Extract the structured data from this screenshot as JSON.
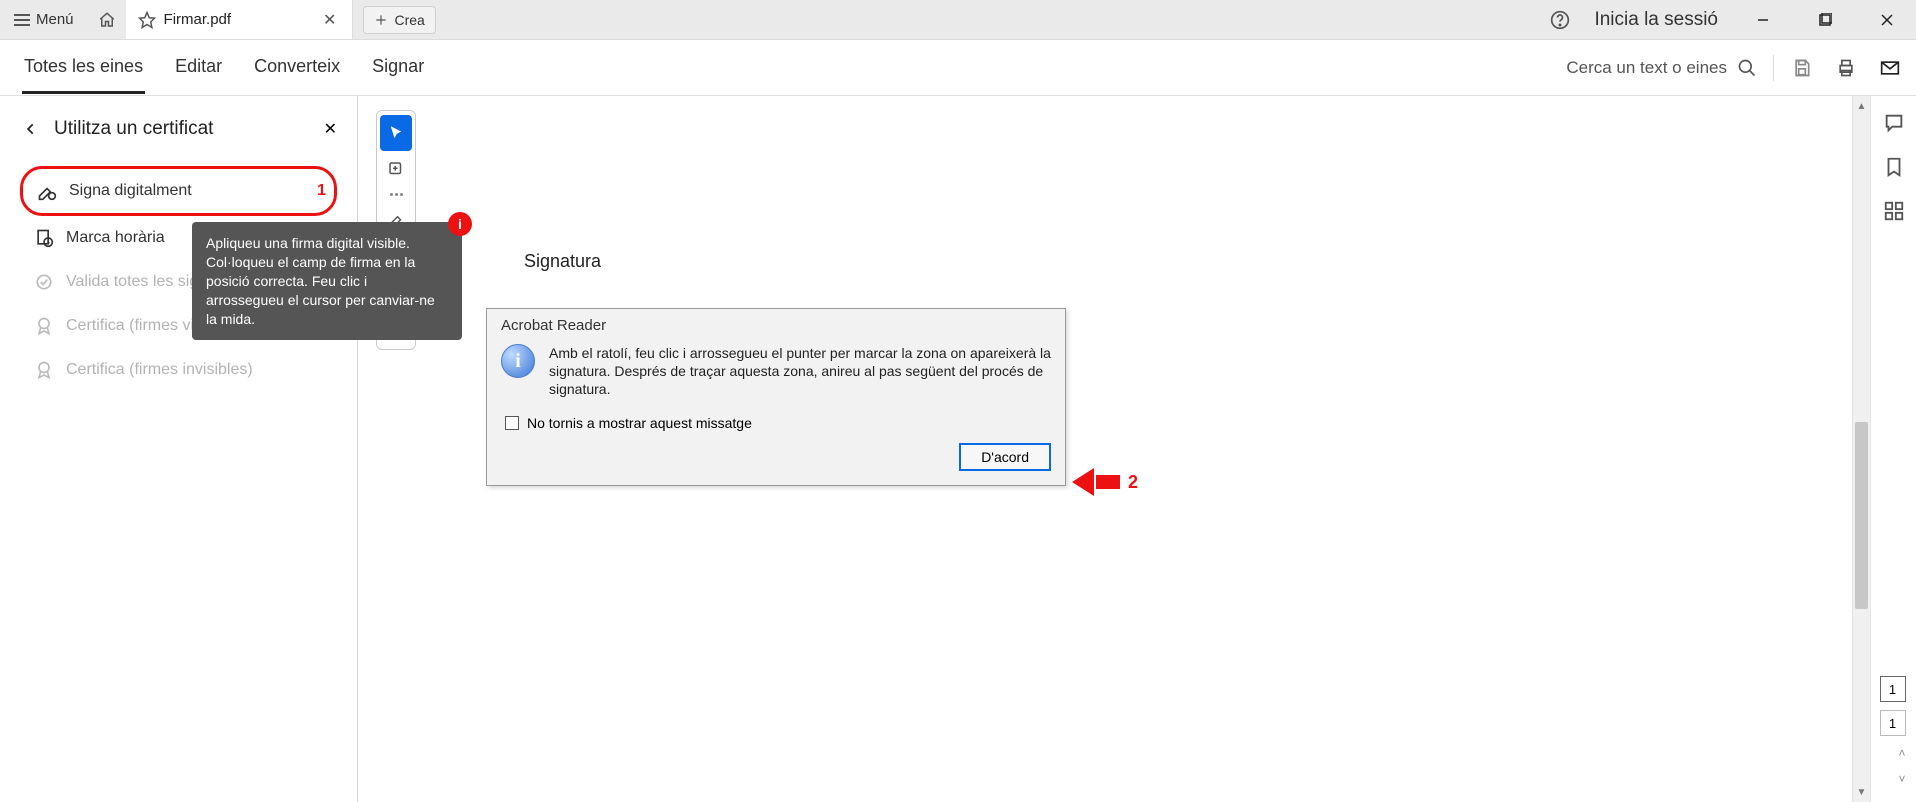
{
  "titlebar": {
    "menu_label": "Menú",
    "tab_title": "Firmar.pdf",
    "create_label": "Crea",
    "signin_label": "Inicia la sessió"
  },
  "toolbar": {
    "nav": {
      "all_tools": "Totes les eines",
      "edit": "Editar",
      "convert": "Converteix",
      "sign": "Signar"
    },
    "search_placeholder": "Cerca un text o eines"
  },
  "left_panel": {
    "title": "Utilitza un certificat",
    "items": {
      "sign_digitally": "Signa digitalment",
      "timestamp": "Marca horària",
      "validate_all": "Valida totes les signatures",
      "certify_visible": "Certifica (firmes visibles)",
      "certify_invisible": "Certifica (firmes invisibles)"
    },
    "tooltip": "Apliqueu una firma digital visible. Col·loqueu el camp de firma en la posició correcta. Feu clic i arrossegueu el cursor per canviar-ne la mida."
  },
  "annotations": {
    "step1": "1",
    "step2": "2",
    "info_badge": "i"
  },
  "document": {
    "heading": "Signatura"
  },
  "dialog": {
    "title": "Acrobat Reader",
    "body": "Amb el ratolí, feu clic i arrossegueu el punter per marcar la zona on apareixerà la signatura. Després de traçar aquesta zona, anireu al pas següent del procés de signatura.",
    "checkbox_label": "No tornis a mostrar aquest missatge",
    "ok_label": "D'acord"
  },
  "pagination": {
    "current": "1",
    "total": "1"
  }
}
